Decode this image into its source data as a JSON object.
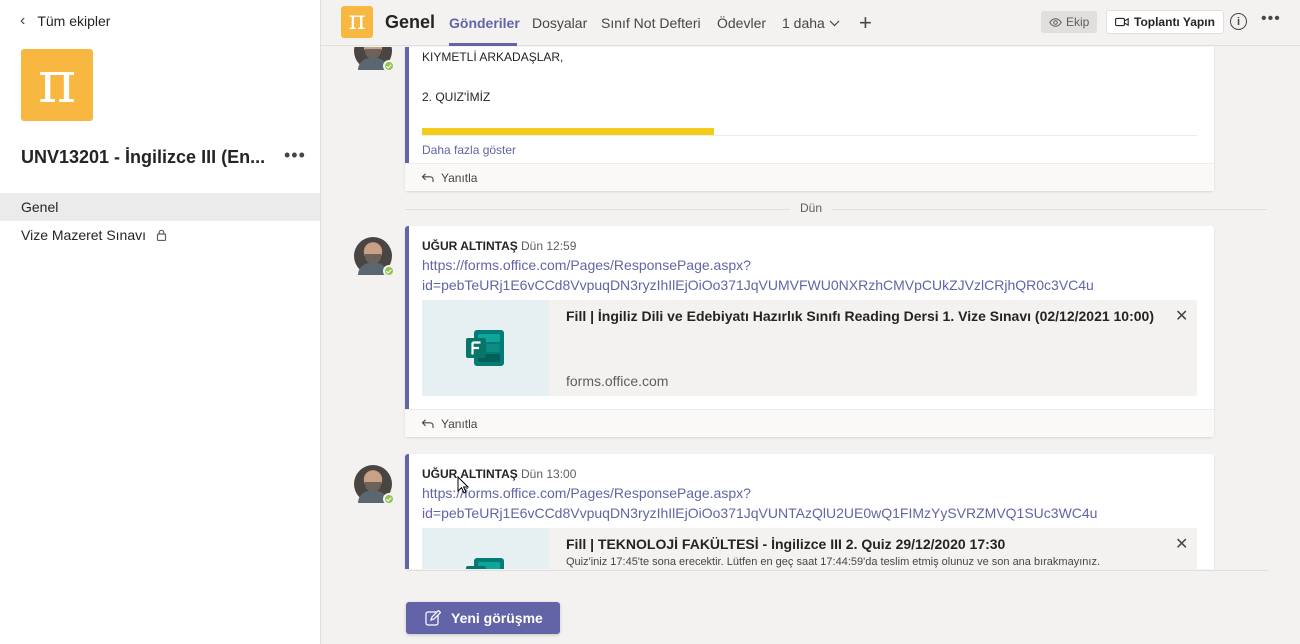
{
  "left_panel": {
    "back_label": "Tüm ekipler",
    "team_logo_glyph": "π",
    "team_name": "UNV13201 - İngilizce III (En...",
    "channels": [
      {
        "label": "Genel",
        "active": true
      },
      {
        "label": "Vize Mazeret Sınavı",
        "locked": true
      }
    ]
  },
  "header": {
    "logo_glyph": "π",
    "title": "Genel",
    "tabs": [
      "Gönderiler",
      "Dosyalar",
      "Sınıf Not Defteri",
      "Ödevler",
      "1 daha"
    ],
    "ekip_label": "Ekip",
    "meet_label": "Toplantı Yapın"
  },
  "feed": {
    "post0": {
      "line1": "KIYMETLİ ARKADAŞLAR,",
      "line2": "2. QUIZ'İMİZ",
      "show_more": "Daha fazla göster",
      "reply": "Yanıtla",
      "highlight_color": "#f2cb1d"
    },
    "divider_label": "Dün",
    "post1": {
      "author": "UĞUR ALTINTAŞ",
      "time": "Dün 12:59",
      "link_line1": "https://forms.office.com/Pages/ResponsePage.aspx?",
      "link_line2": "id=pebTeURj1E6vCCd8VvpuqDN3ryzIhIlEjOiOo371JqVUMVFWU0NXRzhCMVpCUkZJVzlCRjhQR0c3VC4u",
      "card_title": "Fill | İngiliz Dili ve Edebiyatı Hazırlık Sınıfı Reading Dersi 1. Vize Sınavı (02/12/2021 10:00)",
      "card_domain": "forms.office.com",
      "reply": "Yanıtla"
    },
    "post2": {
      "author": "UĞUR ALTINTAŞ",
      "time": "Dün 13:00",
      "link_line1": "https://forms.office.com/Pages/ResponsePage.aspx?",
      "link_line2": "id=pebTeURj1E6vCCd8VvpuqDN3ryzIhIlEjOiOo371JqVUNTAzQlU2UE0wQ1FIMzYySVRZMVQ1SUc3WC4u",
      "card_title": "Fill | TEKNOLOJİ FAKÜLTESİ - İngilizce III 2. Quiz 29/12/2020 17:30",
      "card_desc": "Quiz'iniz 17:45'te sona erecektir. Lütfen en geç saat 17:44:59'da teslim etmiş olunuz ve son ana bırakmayınız."
    }
  },
  "compose": {
    "new_conversation_label": "Yeni görüşme"
  },
  "colors": {
    "accent": "#6264a7",
    "team_logo": "#f8b740",
    "presence": "#92c353"
  }
}
